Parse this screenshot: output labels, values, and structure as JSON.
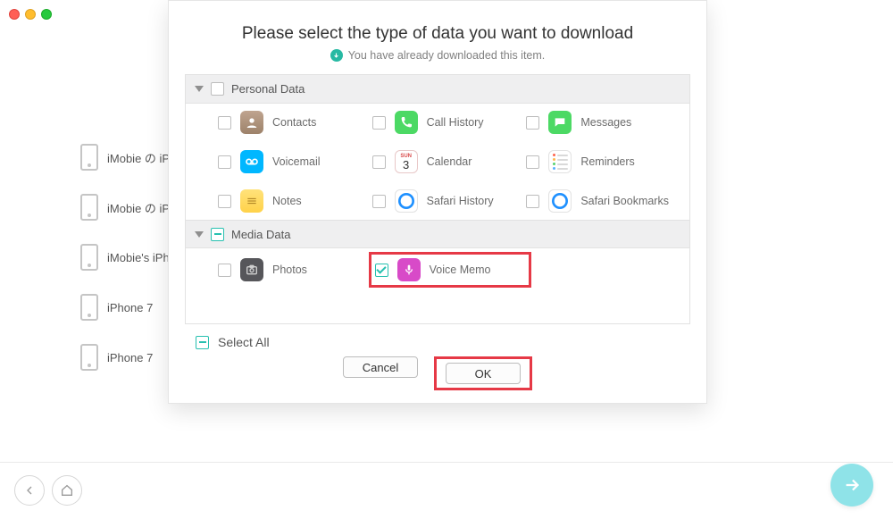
{
  "modal": {
    "title": "Please select the type of data you want to download",
    "subtitle": "You have already downloaded this item.",
    "sections": {
      "personal": {
        "header": "Personal Data",
        "items": {
          "contacts": "Contacts",
          "call_history": "Call History",
          "messages": "Messages",
          "voicemail": "Voicemail",
          "calendar": "Calendar",
          "reminders": "Reminders",
          "notes": "Notes",
          "safari_history": "Safari History",
          "safari_bookmarks": "Safari Bookmarks"
        }
      },
      "media": {
        "header": "Media Data",
        "items": {
          "photos": "Photos",
          "voice_memo": "Voice Memo"
        }
      }
    },
    "select_all": "Select All",
    "buttons": {
      "cancel": "Cancel",
      "ok": "OK"
    }
  },
  "sidebar": {
    "items": [
      "iMobie の iP",
      "iMobie の iP",
      "iMobie's iPh",
      "iPhone 7",
      "iPhone 7"
    ]
  },
  "calendar_icon": {
    "top": "SUN",
    "day": "3"
  },
  "highlight_color": "#e63946"
}
